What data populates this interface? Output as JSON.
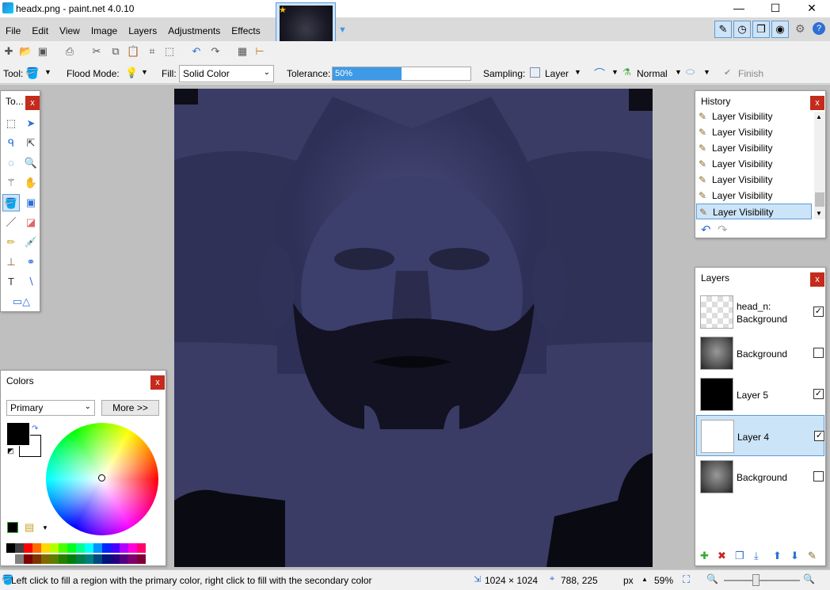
{
  "window": {
    "title": "headx.png - paint.net 4.0.10",
    "minimize": "—",
    "maximize": "☐",
    "close": "✕"
  },
  "menu": [
    "File",
    "Edit",
    "View",
    "Image",
    "Layers",
    "Adjustments",
    "Effects"
  ],
  "options": {
    "tool_label": "Tool:",
    "flood_mode_label": "Flood Mode:",
    "fill_label": "Fill:",
    "fill_value": "Solid Color",
    "tolerance_label": "Tolerance:",
    "tolerance_value": "50%",
    "tolerance_fraction": 0.5,
    "sampling_label": "Sampling:",
    "sampling_value": "Layer",
    "blend_value": "Normal",
    "finish_label": "Finish"
  },
  "tools_panel": {
    "title": "To...",
    "close": "x"
  },
  "history": {
    "title": "History",
    "close": "x",
    "items": [
      "Layer Visibility",
      "Layer Visibility",
      "Layer Visibility",
      "Layer Visibility",
      "Layer Visibility",
      "Layer Visibility",
      "Layer Visibility"
    ],
    "selected_index": 6
  },
  "layers": {
    "title": "Layers",
    "close": "x",
    "items": [
      {
        "name": "head_n:",
        "name2": "Background",
        "visible": true,
        "thumb": "checker"
      },
      {
        "name": "Background",
        "visible": false,
        "thumb": "face"
      },
      {
        "name": "Layer 5",
        "visible": true,
        "thumb": "black"
      },
      {
        "name": "Layer 4",
        "visible": true,
        "thumb": "white",
        "selected": true
      },
      {
        "name": "Background",
        "visible": false,
        "thumb": "face"
      }
    ]
  },
  "colors": {
    "title": "Colors",
    "close": "x",
    "target": "Primary",
    "more_label": "More >>",
    "primary": "#000000",
    "secondary": "#ffffff"
  },
  "status": {
    "hint": "Left click to fill a region with the primary color, right click to fill with the secondary color",
    "image_size": "1024 × 1024",
    "cursor": "788, 225",
    "units": "px",
    "zoom": "59%"
  }
}
